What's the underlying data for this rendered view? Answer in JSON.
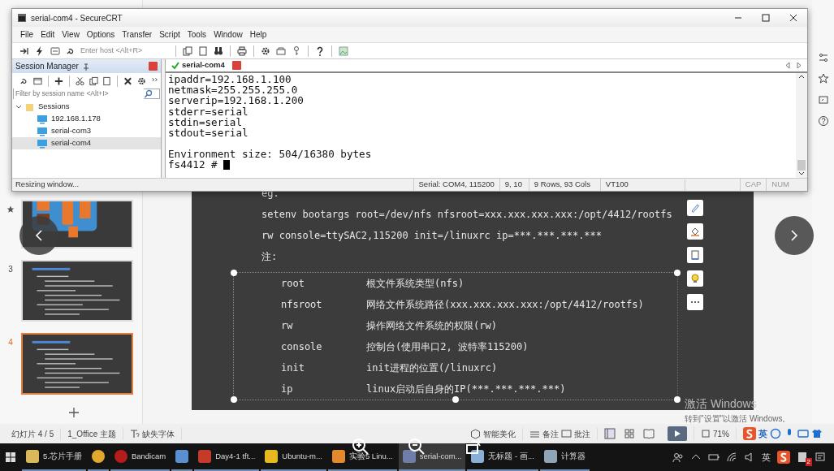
{
  "securecrt": {
    "title": "serial-com4 - SecureCRT",
    "menu": [
      "File",
      "Edit",
      "View",
      "Options",
      "Transfer",
      "Script",
      "Tools",
      "Window",
      "Help"
    ],
    "host_placeholder": "Enter host <Alt+R>",
    "session_manager": {
      "title": "Session Manager",
      "filter_placeholder": "Filter by session name <Alt+I>",
      "tree": [
        {
          "label": "Sessions",
          "expanded": true,
          "children": [
            {
              "label": "192.168.1.178",
              "selected": false
            },
            {
              "label": "serial-com3",
              "selected": false
            },
            {
              "label": "serial-com4",
              "selected": true
            }
          ]
        }
      ]
    },
    "tab": {
      "label": "serial-com4",
      "connected": true
    },
    "terminal": {
      "lines": [
        "ipaddr=192.168.1.100",
        "netmask=255.255.255.0",
        "serverip=192.168.1.200",
        "stderr=serial",
        "stdin=serial",
        "stdout=serial"
      ],
      "summary": "Environment size: 504/16380 bytes",
      "prompt": "fs4412 #"
    },
    "status": "Resizing window...",
    "status_fields": [
      "Serial: COM4, 115200",
      "9,  10",
      "9 Rows, 93 Cols",
      "VT100",
      "CAP",
      "NUM"
    ]
  },
  "presentation": {
    "slides": [
      {
        "kind": "diagram",
        "animated": true,
        "selected": false
      },
      {
        "kind": "text",
        "number": "3",
        "animated": false,
        "selected": false
      },
      {
        "kind": "text",
        "number": "4",
        "animated": false,
        "selected": true
      }
    ],
    "slide": {
      "lines": [
        "eg.",
        "setenv bootargs root=/dev/nfs nfsroot=xxx.xxx.xxx.xxx:/opt/4412/rootfs",
        "rw console=ttySAC2,115200 init=/linuxrc ip=***.***.***.***",
        "注:"
      ],
      "params": [
        {
          "name": "root",
          "desc": "根文件系统类型(nfs)"
        },
        {
          "name": "nfsroot",
          "desc": "网络文件系统路径(xxx.xxx.xxx.xxx:/opt/4412/rootfs)"
        },
        {
          "name": "rw",
          "desc": "操作网络文件系统的权限(rw)"
        },
        {
          "name": "console",
          "desc": "控制台(使用串口2, 波特率115200)"
        },
        {
          "name": "init",
          "desc": "init进程的位置(/linuxrc)"
        },
        {
          "name": "ip",
          "desc": "linux启动后自身的IP(***.***.***.***)"
        }
      ]
    },
    "status_bar": {
      "slide_count": "幻灯片 4 / 5",
      "theme": "1_Office 主题",
      "missing_font": "缺失字体",
      "beautify": "智能美化",
      "notes": "备注",
      "comments": "批注",
      "zoom": "71%",
      "ime": "英"
    }
  },
  "activation": {
    "title": "激活 Windows",
    "subtitle": "转到\"设置\"以激活 Windows。"
  },
  "taskbar": {
    "items": [
      {
        "label": "5.芯片手册",
        "active": false
      },
      {
        "active": false
      },
      {
        "label": "Bandicam",
        "active": false
      },
      {
        "active": false
      },
      {
        "label": "Day4-1 tft...",
        "active": false
      },
      {
        "label": "Ubuntu-m...",
        "active": false
      },
      {
        "label": "实验5 Linu...",
        "active": false
      },
      {
        "label": "serial-com...",
        "active": true
      },
      {
        "label": "无标题 - 画...",
        "active": false
      },
      {
        "label": "计算器",
        "active": false
      }
    ],
    "ime": "英",
    "notifications": "2"
  }
}
